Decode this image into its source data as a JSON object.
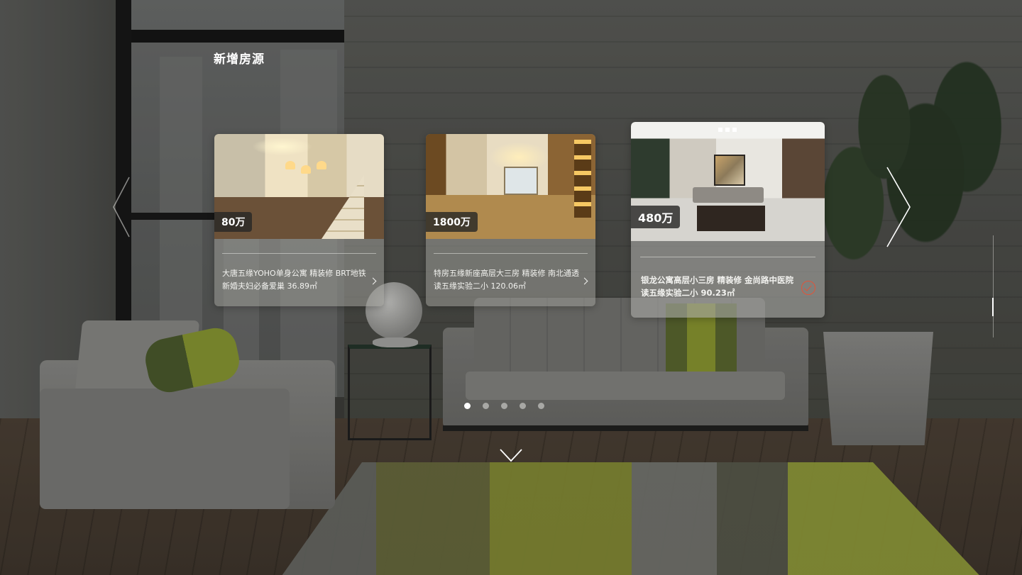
{
  "section": {
    "title": "新增房源"
  },
  "listings": [
    {
      "price": "80万",
      "line1": "大唐五缘YOHO单身公寓 精装修 BRT地铁",
      "line2": "新婚夫妇必备爱巢  36.89㎡",
      "selected": false
    },
    {
      "price": "1800万",
      "line1": "特房五缘新座高层大三房 精装修 南北通透",
      "line2": "读五缘实验二小  120.06㎡",
      "selected": false
    },
    {
      "price": "480万",
      "line1": "银龙公寓高层小三房 精装修 金尚路中医院",
      "line2": "读五缘实验二小  90.23㎡",
      "selected": true
    }
  ],
  "pagination": {
    "total": 5,
    "active_index": 0
  },
  "icons": {
    "prev": "chevron-left-icon",
    "next": "chevron-right-icon",
    "down": "chevron-down-icon",
    "more": "chevron-right-small-icon",
    "selected": "check-circle-icon"
  },
  "colors": {
    "accent": "#e0543a",
    "text": "#ffffff"
  },
  "scroll_indicator": {
    "position_fraction": 0.62
  }
}
